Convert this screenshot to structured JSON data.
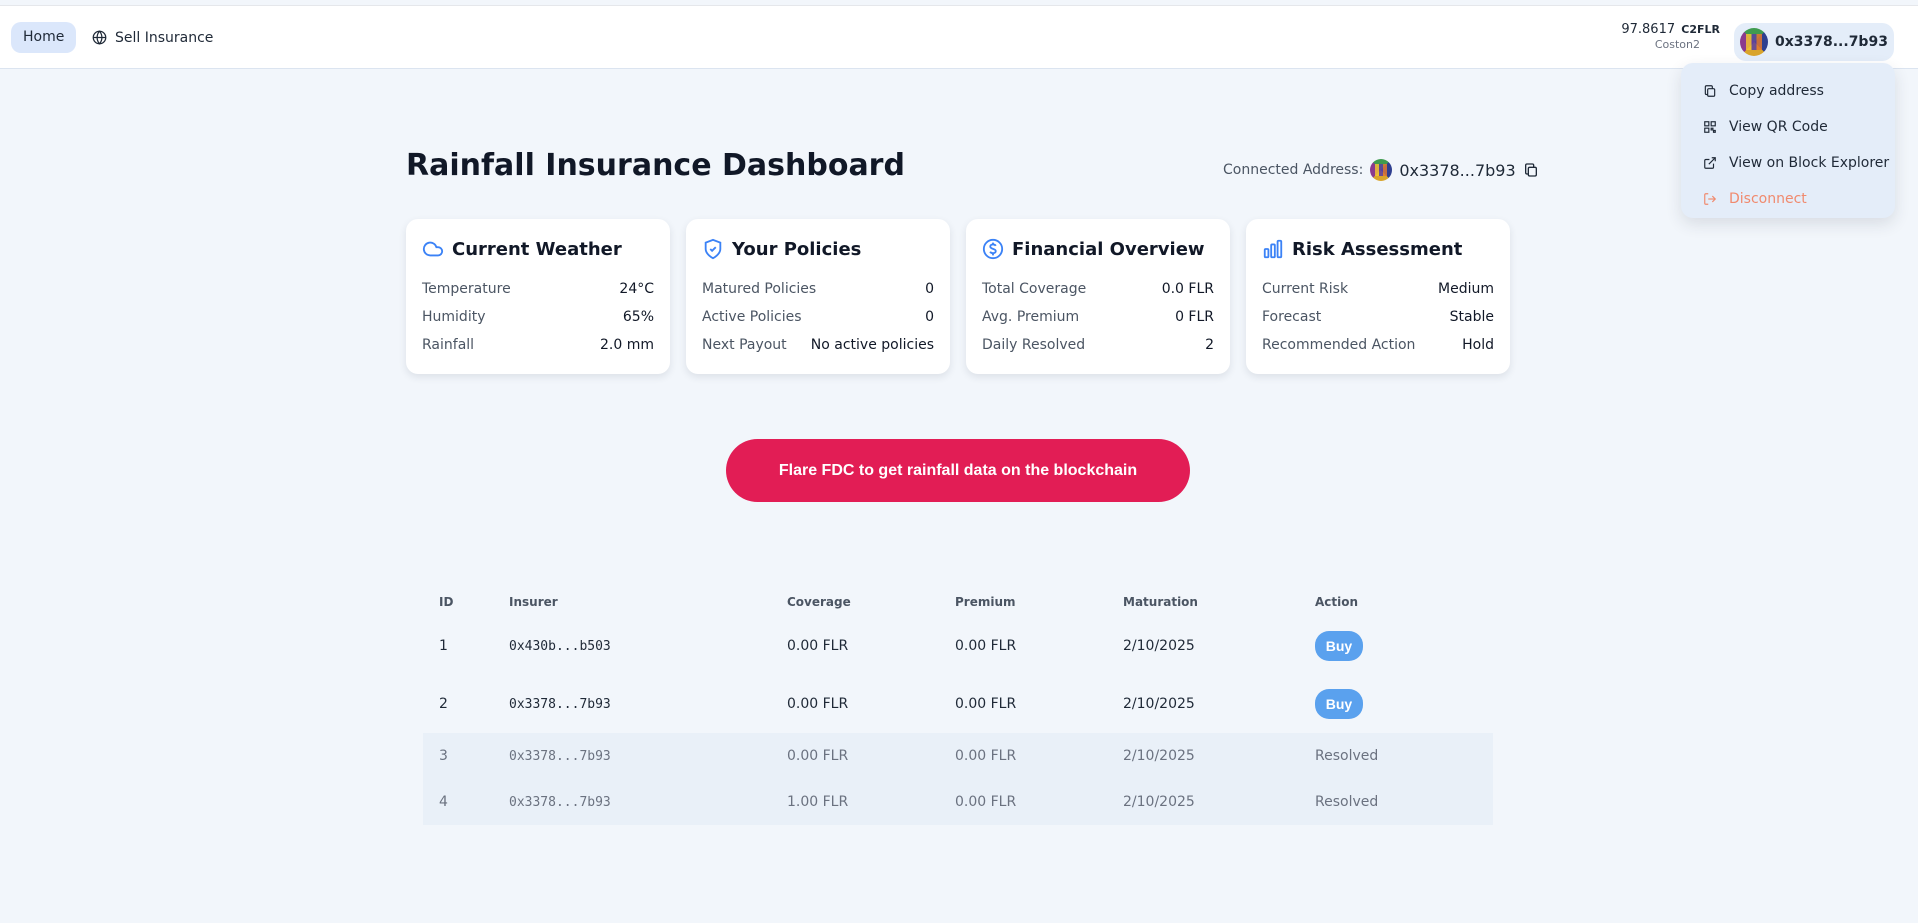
{
  "nav": {
    "home_label": "Home",
    "sell_label": "Sell Insurance"
  },
  "wallet": {
    "balance": "97.8617",
    "currency": "C2FLR",
    "network": "Coston2",
    "address_short": "0x3378...7b93"
  },
  "menu": {
    "items": [
      "Copy address",
      "View QR Code",
      "View on Block Explorer",
      "Disconnect"
    ]
  },
  "dashboard": {
    "title": "Rainfall Insurance Dashboard",
    "connected_label": "Connected Address:",
    "connected_address": "0x3378...7b93"
  },
  "cards": {
    "weather": {
      "title": "Current Weather",
      "rows": [
        [
          "Temperature",
          "24°C"
        ],
        [
          "Humidity",
          "65%"
        ],
        [
          "Rainfall",
          "2.0 mm"
        ]
      ]
    },
    "policies": {
      "title": "Your Policies",
      "rows": [
        [
          "Matured Policies",
          "0"
        ],
        [
          "Active Policies",
          "0"
        ],
        [
          "Next Payout",
          "No active policies"
        ]
      ]
    },
    "financial": {
      "title": "Financial Overview",
      "rows": [
        [
          "Total Coverage",
          "0.0 FLR"
        ],
        [
          "Avg. Premium",
          "0 FLR"
        ],
        [
          "Daily Resolved",
          "2"
        ]
      ]
    },
    "risk": {
      "title": "Risk Assessment",
      "rows": [
        [
          "Current Risk",
          "Medium"
        ],
        [
          "Forecast",
          "Stable"
        ],
        [
          "Recommended Action",
          "Hold"
        ]
      ]
    }
  },
  "cta_label": "Flare FDC to get rainfall data on the blockchain",
  "table": {
    "headers": [
      "ID",
      "Insurer",
      "Coverage",
      "Premium",
      "Maturation",
      "Action"
    ],
    "rows": [
      {
        "id": "1",
        "insurer": "0x430b...b503",
        "coverage": "0.00 FLR",
        "premium": "0.00 FLR",
        "maturation": "2/10/2025",
        "action": "Buy"
      },
      {
        "id": "2",
        "insurer": "0x3378...7b93",
        "coverage": "0.00 FLR",
        "premium": "0.00 FLR",
        "maturation": "2/10/2025",
        "action": "Buy"
      },
      {
        "id": "3",
        "insurer": "0x3378...7b93",
        "coverage": "0.00 FLR",
        "premium": "0.00 FLR",
        "maturation": "2/10/2025",
        "action": "Resolved"
      },
      {
        "id": "4",
        "insurer": "0x3378...7b93",
        "coverage": "1.00 FLR",
        "premium": "0.00 FLR",
        "maturation": "2/10/2025",
        "action": "Resolved"
      }
    ]
  },
  "icons": {
    "sell": "globe-icon",
    "copy": "copy-icon",
    "qr": "qr-code-icon",
    "explorer": "external-link-icon",
    "disconnect": "logout-icon",
    "weather": "cloud-icon",
    "policies": "shield-check-icon",
    "financial": "dollar-circle-icon",
    "risk": "bar-chart-icon"
  },
  "colors": {
    "accent": "#3b82f6",
    "cta": "#e21d55",
    "buy": "#5aa1ee",
    "danger": "#f08a6e",
    "background": "#f2f6fb"
  }
}
